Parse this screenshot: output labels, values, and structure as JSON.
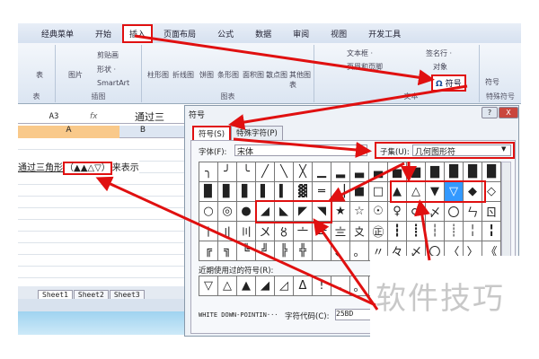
{
  "ribbon": {
    "tabs": [
      "经典菜单",
      "开始",
      "插入",
      "页面布局",
      "公式",
      "数据",
      "审阅",
      "视图",
      "开发工具"
    ],
    "active_tab": "插入",
    "groups": {
      "table": "表",
      "illustrations": "插图",
      "charts": "图表",
      "text": "文本",
      "special": "特殊符号"
    },
    "items": {
      "table": "表",
      "picture": "图片",
      "clipart": "剪贴画",
      "shapes": "形状 ·",
      "smartart": "SmartArt",
      "charts": [
        "柱形图",
        "折线图",
        "饼图",
        "条形图",
        "面积图",
        "散点图",
        "其他图表"
      ],
      "textbox": "文本框 ·",
      "header_footer": "页眉和页脚",
      "signature": "签名行 ·",
      "object": "对象",
      "symbol": "符号",
      "special_symbol": "符号"
    }
  },
  "formula_bar": {
    "name_box": "A3",
    "fx": "fx",
    "content": "通过三"
  },
  "sheet": {
    "col_a": "A",
    "col_b": "B",
    "cell_text": "通过三角形",
    "cell_symbols": "（▲▲△▽）",
    "cell_after": "来表示",
    "tabs": [
      "Sheet1",
      "Sheet2",
      "Sheet3"
    ]
  },
  "dialog": {
    "title": "符号",
    "help": "?",
    "close": "X",
    "tabs": [
      "符号(S)",
      "特殊字符(P)"
    ],
    "font_label": "字体(F):",
    "font_value": "宋体",
    "subset_label": "子集(U):",
    "subset_value": "几何图形符",
    "symbols": [
      "╮",
      "╯",
      "╰",
      "╱",
      "╲",
      "╳",
      "▁",
      "▂",
      "▃",
      "▄",
      "▅",
      "▆",
      "▇",
      "█",
      "█",
      "█",
      "▉",
      "▊",
      "▋",
      "▌",
      "▍",
      "▓",
      "═",
      "▕",
      "■",
      "□",
      "▲",
      "△",
      "▼",
      "▽",
      "◆",
      "◇",
      "○",
      "◎",
      "●",
      "◢",
      "◣",
      "◤",
      "◥",
      "★",
      "☆",
      "☉",
      "♀",
      "♂",
      "〆",
      "〇",
      "ㄣ",
      "ㄖ",
      "〡",
      "〢",
      "〣",
      "〤",
      "〥",
      "〦",
      "〧",
      "〨",
      "〩",
      "㊣",
      "┇",
      "┋",
      "┆",
      "┊",
      "╎",
      "╏",
      "╔",
      "╗",
      "╚",
      "╝",
      "╠",
      "╬",
      "",
      "、",
      "。",
      "〃",
      "々",
      "〆",
      "〇",
      "〈",
      "〉",
      "《"
    ],
    "selected_symbol": "▽",
    "recent_label": "近期使用过的符号(R):",
    "recent": [
      "▽",
      "△",
      "▲",
      "◢",
      "◿",
      "Δ",
      "!",
      ",",
      "。",
      "",
      "",
      "",
      "",
      "",
      "",
      ""
    ],
    "char_name": "WHITE DOWN-POINTIN···",
    "code_label": "字符代码(C):",
    "code_value": "25BD"
  },
  "watermark": "软件技巧",
  "colors": {
    "annotation": "#e01010",
    "selection": "#3399ff"
  }
}
